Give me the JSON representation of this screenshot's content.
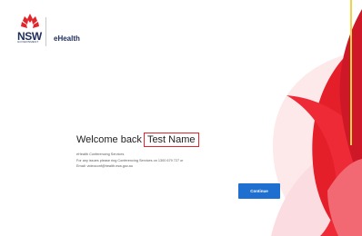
{
  "brand": {
    "logo_text": "NSW",
    "logo_subtext": "GOVERNMENT",
    "app_name": "eHealth"
  },
  "main": {
    "welcome_prefix": "Welcome back",
    "user_name": "Test Name",
    "info_lines": [
      "eHealth Conferencing Services",
      "For any issues please ring Conferencing Services on 1300 679 727 or",
      "Email: videoconf@health.nsw.gov.au"
    ],
    "continue_label": "Continue"
  },
  "colors": {
    "accent_red": "#e0262c",
    "button_blue": "#1f6fd0",
    "brand_navy": "#1d2d5c"
  }
}
